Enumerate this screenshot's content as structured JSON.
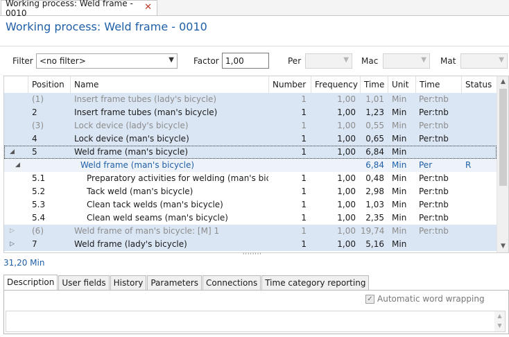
{
  "tab": {
    "title": "Working process: Weld frame - 0010",
    "close": "✕"
  },
  "page_title": "Working process: Weld frame - 0010",
  "filters": {
    "filter_label": "Filter",
    "filter_value": "<no filter>",
    "factor_label": "Factor",
    "factor_value": "1,00",
    "per_label": "Per",
    "mac_label": "Mac",
    "mat_label": "Mat"
  },
  "grid": {
    "columns": [
      "Position",
      "Name",
      "Number",
      "Frequency",
      "Time",
      "Unit",
      "Time type",
      "Status"
    ],
    "rows": [
      {
        "expander": "",
        "position": "(1)",
        "name": "Insert frame tubes  (lady's bicycle)",
        "number": "1",
        "frequency": "1,00",
        "time": "1,01",
        "unit": "Min",
        "time_type": "Per:tnb",
        "status": "",
        "style": "grey"
      },
      {
        "expander": "",
        "position": "2",
        "name": "Insert frame tubes (man's bicycle)",
        "number": "1",
        "frequency": "1,00",
        "time": "1,23",
        "unit": "Min",
        "time_type": "Per:tnb",
        "status": "",
        "style": "normal"
      },
      {
        "expander": "",
        "position": "(3)",
        "name": "Lock device  (lady's bicycle)",
        "number": "1",
        "frequency": "1,00",
        "time": "0,55",
        "unit": "Min",
        "time_type": "Per:tnb",
        "status": "",
        "style": "grey"
      },
      {
        "expander": "",
        "position": "4",
        "name": "Lock device  (man's bicycle)",
        "number": "1",
        "frequency": "1,00",
        "time": "0,65",
        "unit": "Min",
        "time_type": "Per:tnb",
        "status": "",
        "style": "normal"
      },
      {
        "expander": "◢",
        "position": "5",
        "name": "Weld frame  (man's bicycle)",
        "number": "1",
        "frequency": "1,00",
        "time": "6,84",
        "unit": "Min",
        "time_type": "",
        "status": "",
        "style": "selected"
      },
      {
        "expander": "◢",
        "position": "",
        "name": "Weld frame (man's bicycle)",
        "number": "",
        "frequency": "",
        "time": "6,84",
        "unit": "Min",
        "time_type": "Per",
        "status": "R",
        "style": "sub"
      },
      {
        "expander": "",
        "position": "5.1",
        "name": "Preparatory activities for welding (man's bicycle)",
        "number": "1",
        "frequency": "1,00",
        "time": "0,48",
        "unit": "Min",
        "time_type": "Per:tnb",
        "status": "",
        "style": "child"
      },
      {
        "expander": "",
        "position": "5.2",
        "name": "Tack weld (man's bicycle)",
        "number": "1",
        "frequency": "1,00",
        "time": "2,98",
        "unit": "Min",
        "time_type": "Per:tnb",
        "status": "",
        "style": "child"
      },
      {
        "expander": "",
        "position": "5.3",
        "name": "Clean tack welds (man's bicycle)",
        "number": "1",
        "frequency": "1,00",
        "time": "1,03",
        "unit": "Min",
        "time_type": "Per:tnb",
        "status": "",
        "style": "child"
      },
      {
        "expander": "",
        "position": "5.4",
        "name": "Clean weld seams (man's bicycle)",
        "number": "1",
        "frequency": "1,00",
        "time": "2,35",
        "unit": "Min",
        "time_type": "Per:tnb",
        "status": "",
        "style": "child"
      },
      {
        "expander": "▷",
        "position": "(6)",
        "name": "Weld frame of man's bicycle: [M] 1",
        "number": "1",
        "frequency": "1,00",
        "time": "19,74",
        "unit": "Min",
        "time_type": "Per:tnb",
        "status": "",
        "style": "grey"
      },
      {
        "expander": "▷",
        "position": "7",
        "name": "Weld frame  (lady's bicycle)",
        "number": "1",
        "frequency": "1,00",
        "time": "5,16",
        "unit": "Min",
        "time_type": "",
        "status": "",
        "style": "normal"
      }
    ]
  },
  "total": "31,20 Min",
  "bottom_tabs": [
    "Description",
    "User fields",
    "History",
    "Parameters",
    "Connections",
    "Time category reporting"
  ],
  "active_bottom_tab": "Description",
  "word_wrap": {
    "label": "Automatic word wrapping",
    "checked": true
  },
  "colors": {
    "accent": "#1f5fa8",
    "row_shade": "#dbe6f4",
    "close_red": "#c0392b"
  }
}
